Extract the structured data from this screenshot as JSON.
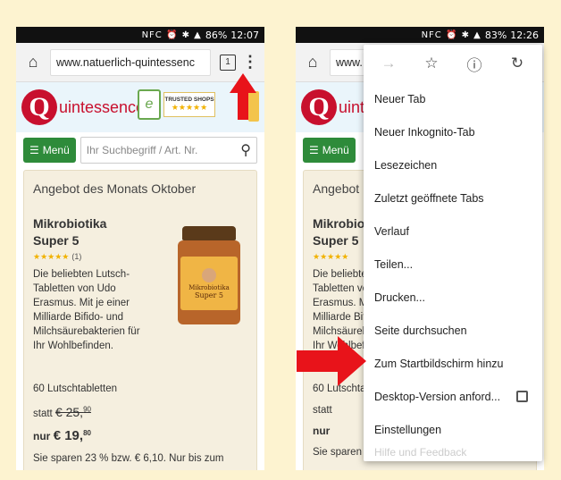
{
  "left": {
    "status": {
      "icons": "NFC ⏰ ✱ ▲",
      "battery": "86%",
      "time": "12:07"
    },
    "url": "www.natuerlich-quintessenc",
    "tab_count": "1",
    "menu_glyph": "⋮",
    "brand": "uintessence",
    "logo_letter": "Q",
    "trusted": "TRUSTED SHOPS",
    "stars": "★★★★★",
    "menu_button": "Menü",
    "search_placeholder": "Ihr Suchbegriff / Art. Nr.",
    "offer": {
      "title": "Angebot des Monats Oktober",
      "product_name": "Mikrobiotika Super 5",
      "rating_stars": "★★★★★",
      "rating_count": "(1)",
      "description": "Die beliebten Lutsch-Tabletten von Udo Erasmus. Mit je einer Milliarde Bifido- und Milchsäurebakterien für Ihr Wohlbefinden.",
      "pack": "60 Lutschtabletten",
      "old_label": "statt",
      "old_price": "€ 25,",
      "old_cents": "90",
      "new_label": "nur",
      "new_price": "€ 19,",
      "new_cents": "80",
      "save": "Sie sparen 23 % bzw. € 6,10. Nur bis zum",
      "jar_label1": "Mikrobiotika",
      "jar_label2": "Super 5"
    }
  },
  "right": {
    "status": {
      "icons": "NFC ⏰ ✱ ▲",
      "battery": "83%",
      "time": "12:26"
    },
    "url": "www.",
    "menu_icons": {
      "forward": "→",
      "bookmark": "☆",
      "info": "ⓘ",
      "reload": "↻"
    },
    "menu_items": [
      "Neuer Tab",
      "Neuer Inkognito-Tab",
      "Lesezeichen",
      "Zuletzt geöffnete Tabs",
      "Verlauf",
      "Teilen...",
      "Drucken...",
      "Seite durchsuchen",
      "Zum Startbildschirm hinzu",
      "Desktop-Version anford...",
      "Einstellungen"
    ],
    "faded_item": "Hilfe und Feedback",
    "offer_title": "Angebot",
    "product_name": "Mikrobiotika Super 5"
  },
  "colors": {
    "arrow": "#e8131a",
    "brand": "#c8102e",
    "menu_green": "#2e8b3a"
  }
}
